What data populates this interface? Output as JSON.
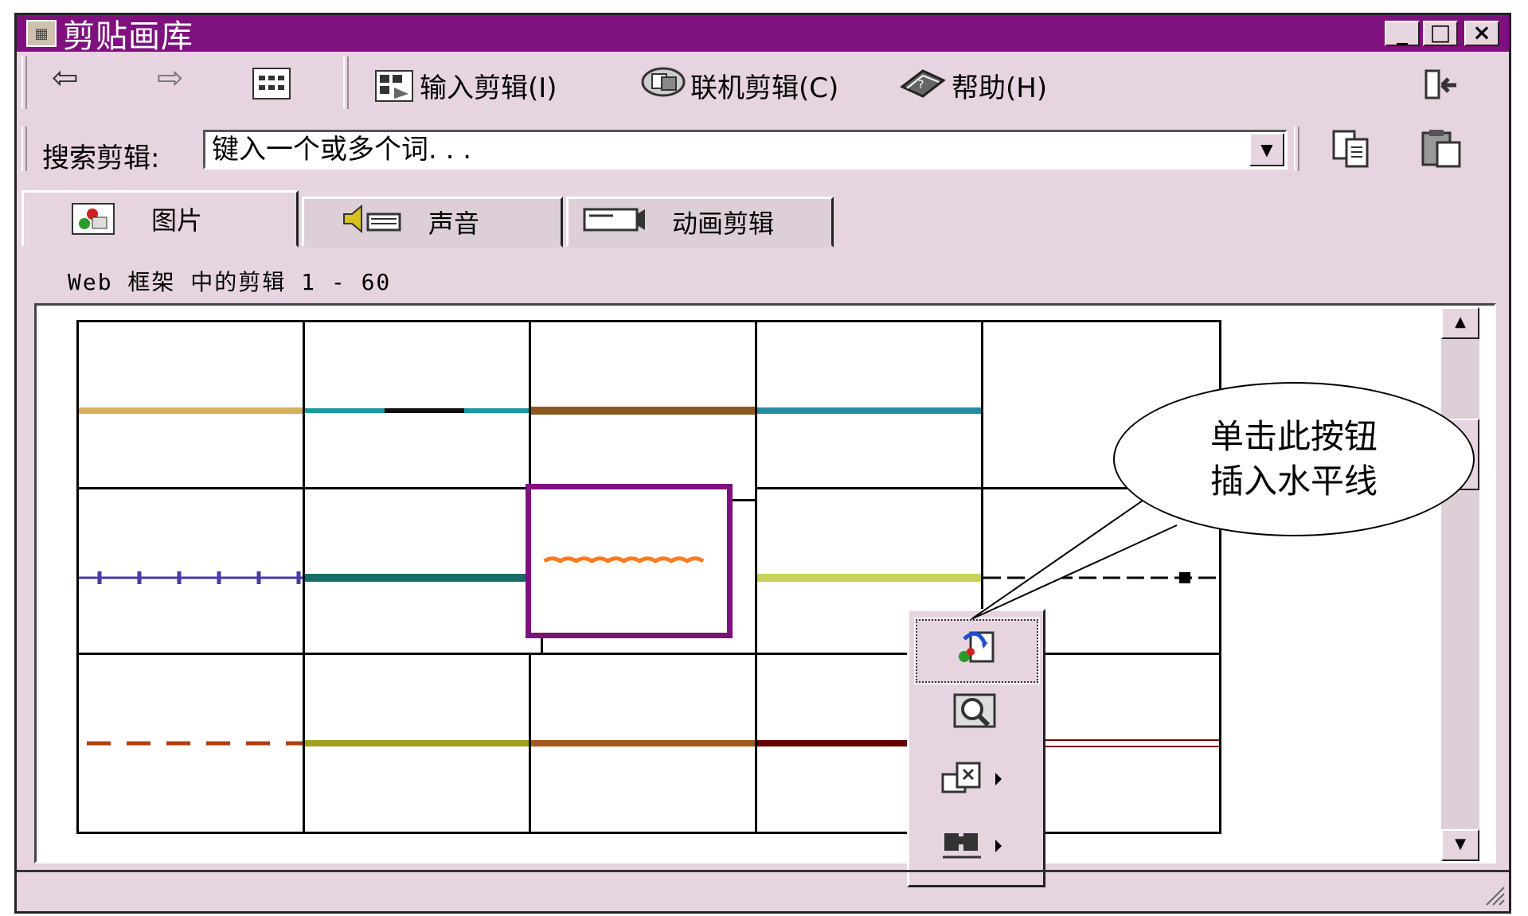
{
  "window": {
    "title": "剪贴画库",
    "minimize_glyph": "_",
    "maximize_glyph": "□",
    "close_glyph": "×"
  },
  "toolbar": {
    "back_glyph": "⇦",
    "forward_glyph": "⇨",
    "import_label": "输入剪辑(I)",
    "online_label": "联机剪辑(C)",
    "help_label": "帮助(H)"
  },
  "search": {
    "label": "搜索剪辑:",
    "value": "键入一个或多个词. . ."
  },
  "tabs": [
    {
      "label": "图片"
    },
    {
      "label": "声音"
    },
    {
      "label": "动画剪辑"
    }
  ],
  "gallery": {
    "clip_count": "Web 框架 中的剪辑 1 - 60",
    "thumbnails": [
      {
        "color": "#d4b060",
        "style": "solid",
        "thickness": 8
      },
      {
        "color": "#1a9aa0",
        "style": "segment",
        "thickness": 6
      },
      {
        "color": "#8a5a20",
        "style": "solid",
        "thickness": 10
      },
      {
        "color": "#2a8aa0",
        "style": "solid",
        "thickness": 8
      },
      {
        "color": "#888888",
        "style": "hidden",
        "thickness": 4
      },
      {
        "color": "#4a3aa8",
        "style": "ticks",
        "thickness": 3
      },
      {
        "color": "#1a6a6a",
        "style": "solid",
        "thickness": 10
      },
      {
        "color": "#ff7a20",
        "style": "wavy",
        "thickness": 6
      },
      {
        "color": "#c8d060",
        "style": "solid",
        "thickness": 10
      },
      {
        "color": "#000000",
        "style": "dashdot",
        "thickness": 3
      },
      {
        "color": "#b04010",
        "style": "dashed",
        "thickness": 5
      },
      {
        "color": "#a0a020",
        "style": "solid",
        "thickness": 8
      },
      {
        "color": "#a05a20",
        "style": "solid",
        "thickness": 8
      },
      {
        "color": "#600000",
        "style": "solid",
        "thickness": 8
      },
      {
        "color": "#800000",
        "style": "double",
        "thickness": 2
      }
    ]
  },
  "scrollbar": {
    "up_glyph": "▲",
    "down_glyph": "▼"
  },
  "popup": {
    "insert_icon": "insert-clip-icon",
    "preview_icon": "preview-icon",
    "category_icon": "add-category-icon",
    "find_icon": "find-similar-icon"
  },
  "callout": {
    "line1": "单击此按钮",
    "line2": "插入水平线"
  }
}
